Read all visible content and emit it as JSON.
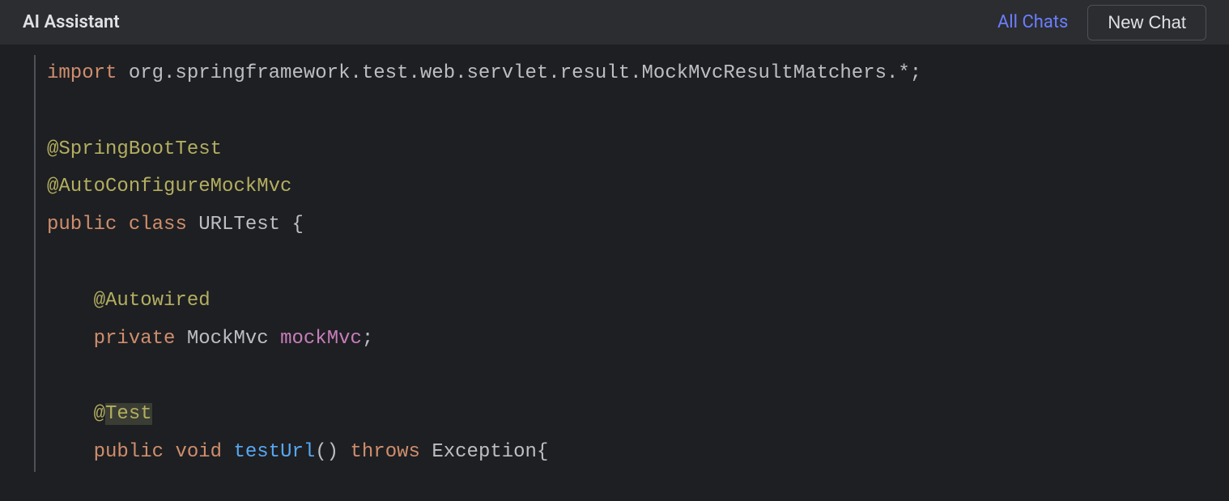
{
  "header": {
    "title": "AI Assistant",
    "all_chats": "All Chats",
    "new_chat": "New Chat"
  },
  "code": {
    "tokens": [
      [
        {
          "cls": "kw-import",
          "text": "import"
        },
        {
          "cls": "plain",
          "text": " org.springframework.test.web.servlet.result.MockMvcResultMatchers.*;"
        }
      ],
      [],
      [
        {
          "cls": "annotation",
          "text": "@SpringBootTest"
        }
      ],
      [
        {
          "cls": "annotation",
          "text": "@AutoConfigureMockMvc"
        }
      ],
      [
        {
          "cls": "kw-public",
          "text": "public"
        },
        {
          "cls": "plain",
          "text": " "
        },
        {
          "cls": "kw-class",
          "text": "class"
        },
        {
          "cls": "plain",
          "text": " "
        },
        {
          "cls": "class-name",
          "text": "URLTest"
        },
        {
          "cls": "plain",
          "text": " {"
        }
      ],
      [],
      [
        {
          "cls": "plain",
          "text": "    "
        },
        {
          "cls": "annotation",
          "text": "@Autowired"
        }
      ],
      [
        {
          "cls": "plain",
          "text": "    "
        },
        {
          "cls": "kw-private",
          "text": "private"
        },
        {
          "cls": "plain",
          "text": " "
        },
        {
          "cls": "type-name",
          "text": "MockMvc"
        },
        {
          "cls": "plain",
          "text": " "
        },
        {
          "cls": "var-name",
          "text": "mockMvc"
        },
        {
          "cls": "punct",
          "text": ";"
        }
      ],
      [],
      [
        {
          "cls": "plain",
          "text": "    "
        },
        {
          "cls": "annotation",
          "text": "@"
        },
        {
          "cls": "annotation-hl",
          "text": "Test"
        }
      ],
      [
        {
          "cls": "plain",
          "text": "    "
        },
        {
          "cls": "kw-public",
          "text": "public"
        },
        {
          "cls": "plain",
          "text": " "
        },
        {
          "cls": "kw-void",
          "text": "void"
        },
        {
          "cls": "plain",
          "text": " "
        },
        {
          "cls": "method-name",
          "text": "testUrl"
        },
        {
          "cls": "punct",
          "text": "()"
        },
        {
          "cls": "plain",
          "text": " "
        },
        {
          "cls": "kw-throws",
          "text": "throws"
        },
        {
          "cls": "plain",
          "text": " "
        },
        {
          "cls": "type-name",
          "text": "Exception"
        },
        {
          "cls": "punct",
          "text": "{"
        }
      ]
    ]
  }
}
